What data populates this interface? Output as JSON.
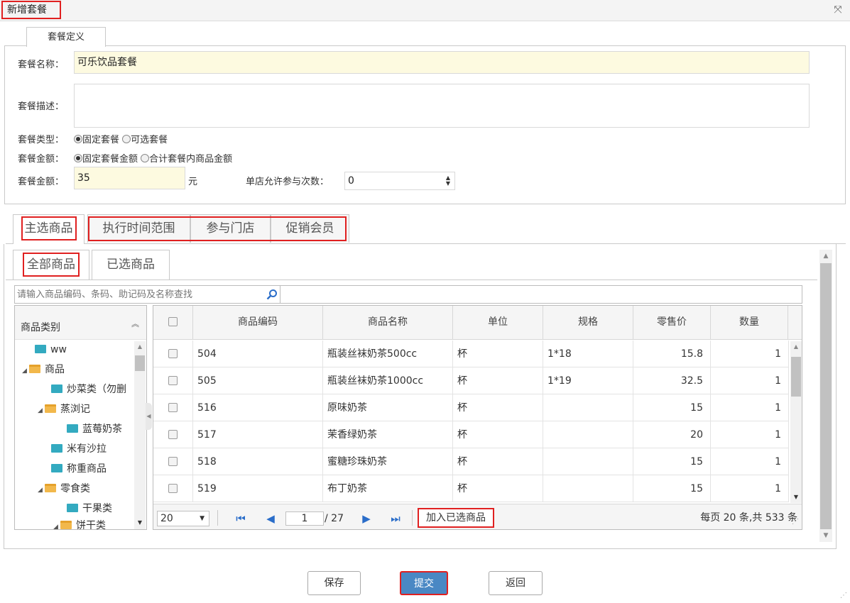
{
  "window": {
    "title": "新增套餐",
    "close_icon": "close-icon"
  },
  "form": {
    "section_title": "套餐定义",
    "name_label": "套餐名称：",
    "name_value": "可乐饮品套餐",
    "desc_label": "套餐描述：",
    "desc_value": "",
    "type_label": "套餐类型：",
    "type_options": [
      "固定套餐",
      "可选套餐"
    ],
    "type_selected": "固定套餐",
    "amount_mode_label": "套餐金额：",
    "amount_mode_options": [
      "固定套餐金额",
      "合计套餐内商品金额"
    ],
    "amount_mode_selected": "固定套餐金额",
    "amount_label": "套餐金额：",
    "amount_value": "35",
    "amount_unit": "元",
    "limit_label": "单店允许参与次数：",
    "limit_value": "0"
  },
  "tabs": [
    "主选商品",
    "执行时间范围",
    "参与门店",
    "促销会员"
  ],
  "subtabs": [
    "全部商品",
    "已选商品"
  ],
  "search": {
    "placeholder": "请输入商品编码、条码、助记码及名称查找"
  },
  "tree": {
    "header": "商品类别",
    "items": [
      "ww",
      "商品",
      "炒菜类（勿删",
      "蒸浏记",
      "蓝莓奶茶",
      "米有沙拉",
      "称重商品",
      "零食类",
      "干果类",
      "饼干类"
    ]
  },
  "grid": {
    "columns": [
      "商品编码",
      "商品名称",
      "单位",
      "规格",
      "零售价",
      "数量"
    ],
    "rows": [
      {
        "code": "504",
        "name": "瓶装丝袜奶茶500cc",
        "unit": "杯",
        "spec": "1*18",
        "price": "15.8",
        "qty": "1"
      },
      {
        "code": "505",
        "name": "瓶装丝袜奶茶1000cc",
        "unit": "杯",
        "spec": "1*19",
        "price": "32.5",
        "qty": "1"
      },
      {
        "code": "516",
        "name": "原味奶茶",
        "unit": "杯",
        "spec": "",
        "price": "15",
        "qty": "1"
      },
      {
        "code": "517",
        "name": "茉香绿奶茶",
        "unit": "杯",
        "spec": "",
        "price": "20",
        "qty": "1"
      },
      {
        "code": "518",
        "name": "蜜糖珍珠奶茶",
        "unit": "杯",
        "spec": "",
        "price": "15",
        "qty": "1"
      },
      {
        "code": "519",
        "name": "布丁奶茶",
        "unit": "杯",
        "spec": "",
        "price": "15",
        "qty": "1"
      }
    ]
  },
  "pager": {
    "page_size": "20",
    "current_page": "1",
    "total_pages": "/ 27",
    "add_button": "加入已选商品",
    "summary": "每页 20 条,共 533 条"
  },
  "actions": {
    "save": "保存",
    "submit": "提交",
    "back": "返回"
  },
  "colors": {
    "highlight": "#e02020",
    "primary": "#4a88c4",
    "input_yellow": "#fdfae0"
  }
}
